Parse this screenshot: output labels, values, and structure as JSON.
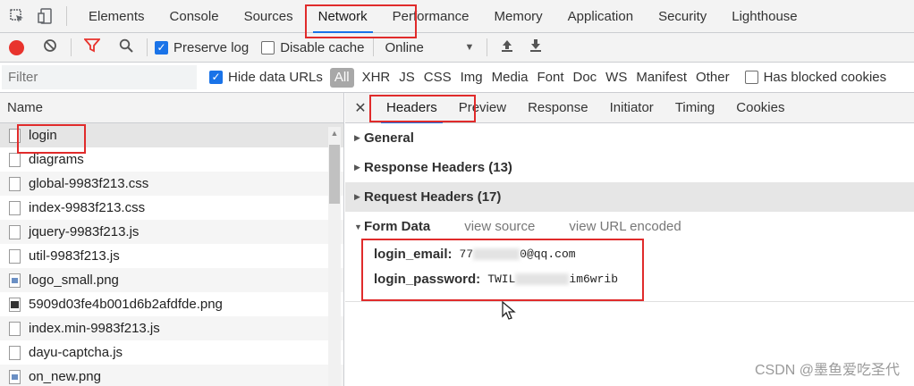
{
  "devtools_tabs": [
    "Elements",
    "Console",
    "Sources",
    "Network",
    "Performance",
    "Memory",
    "Application",
    "Security",
    "Lighthouse"
  ],
  "active_tab": "Network",
  "toolbar": {
    "preserve_log_label": "Preserve log",
    "preserve_log_checked": true,
    "disable_cache_label": "Disable cache",
    "disable_cache_checked": false,
    "throttling_value": "Online"
  },
  "filter": {
    "placeholder": "Filter",
    "hide_data_urls_label": "Hide data URLs",
    "types": [
      "All",
      "XHR",
      "JS",
      "CSS",
      "Img",
      "Media",
      "Font",
      "Doc",
      "WS",
      "Manifest",
      "Other"
    ],
    "has_blocked_cookies_label": "Has blocked cookies"
  },
  "request_list": {
    "header": "Name",
    "items": [
      {
        "name": "login",
        "icon": "document-icon"
      },
      {
        "name": "diagrams",
        "icon": "document-icon"
      },
      {
        "name": "global-9983f213.css",
        "icon": "document-icon"
      },
      {
        "name": "index-9983f213.css",
        "icon": "document-icon"
      },
      {
        "name": "jquery-9983f213.js",
        "icon": "document-icon"
      },
      {
        "name": "util-9983f213.js",
        "icon": "document-icon"
      },
      {
        "name": "logo_small.png",
        "icon": "image-icon"
      },
      {
        "name": "5909d03fe4b001d6b2afdfde.png",
        "icon": "image-icon"
      },
      {
        "name": "index.min-9983f213.js",
        "icon": "document-icon"
      },
      {
        "name": "dayu-captcha.js",
        "icon": "document-icon"
      },
      {
        "name": "on_new.png",
        "icon": "image-icon"
      }
    ]
  },
  "detail": {
    "tabs": [
      "Headers",
      "Preview",
      "Response",
      "Initiator",
      "Timing",
      "Cookies"
    ],
    "active_tab": "Headers",
    "general": "General",
    "response_headers": "Response Headers (13)",
    "request_headers": "Request Headers (17)",
    "form_data": "Form Data",
    "view_source": "view source",
    "view_url_encoded": "view URL encoded",
    "fields": [
      {
        "key": "login_email:",
        "value_prefix": "77",
        "value_suffix": "0@qq.com"
      },
      {
        "key": "login_password:",
        "value_prefix": "TWIL",
        "value_suffix": "im6wrib"
      }
    ]
  },
  "watermark": "CSDN @墨鱼爱吃圣代",
  "colors": {
    "accent": "#1a73e8",
    "record": "#e8332d",
    "annotation": "#e02b2b"
  }
}
